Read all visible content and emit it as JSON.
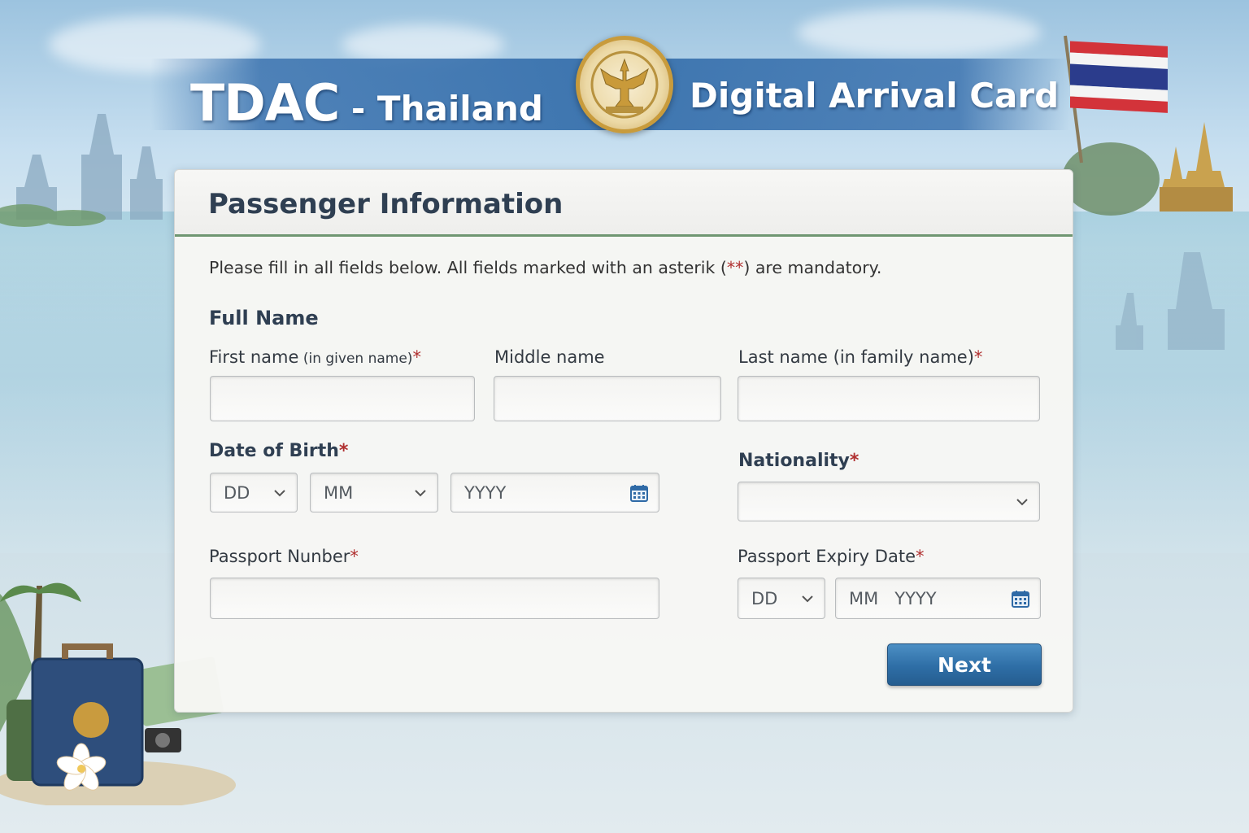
{
  "header": {
    "title_abbrev": "TDAC",
    "title_left_rest": " - Thailand",
    "title_right": "Digital Arrival Card",
    "seal_icon": "garuda-seal-icon",
    "flag_icon": "thai-flag-icon"
  },
  "form": {
    "title": "Passenger Information",
    "intro_prefix": "Please fill in all fields below. All fields marked with an asterik (",
    "intro_stars": "**",
    "intro_suffix": ") are mandatory.",
    "required_mark": "*",
    "full_name_section": "Full Name",
    "first_name": {
      "label": "First name",
      "hint": " (in given name)",
      "value": ""
    },
    "middle_name": {
      "label": "Middle name",
      "value": ""
    },
    "last_name": {
      "label": "Last name (in family name)",
      "value": ""
    },
    "dob": {
      "label": "Date of Birth",
      "day": "DD",
      "month": "MM",
      "year": "YYYY"
    },
    "nationality": {
      "label": "Nationality",
      "value": ""
    },
    "passport_number": {
      "label": "Passport Nunber",
      "value": ""
    },
    "passport_expiry": {
      "label": "Passport Expiry Date",
      "day": "DD",
      "month": "MM",
      "year": "YYYY"
    },
    "next_label": "Next"
  },
  "colors": {
    "banner_blue": "#3a72ae",
    "header_rule": "#6f9671",
    "required": "#b03030",
    "button": "#2e6ea6"
  }
}
